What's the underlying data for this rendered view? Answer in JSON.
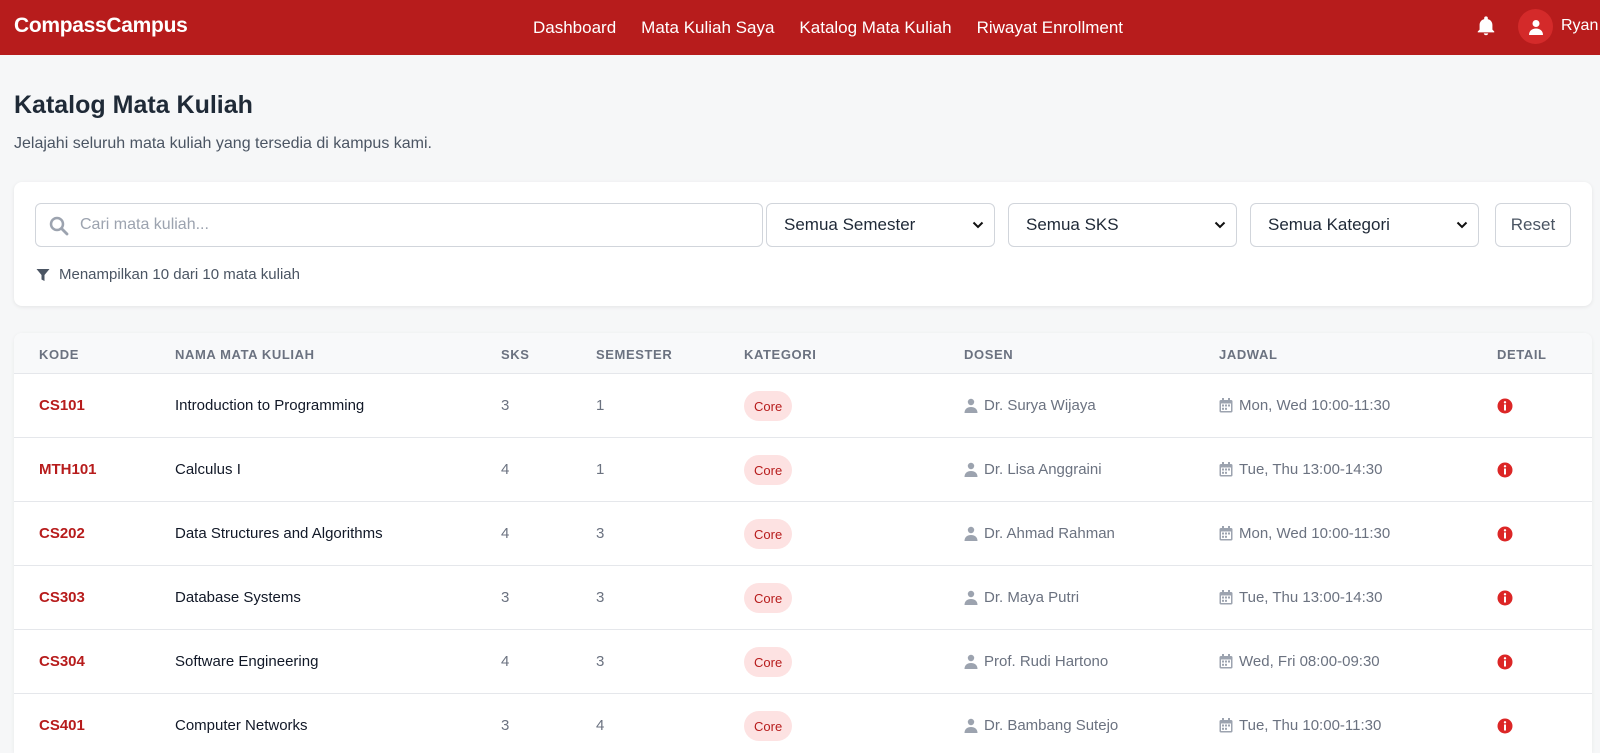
{
  "navbar": {
    "brand": "CompassCampus",
    "links": [
      "Dashboard",
      "Mata Kuliah Saya",
      "Katalog Mata Kuliah",
      "Riwayat Enrollment"
    ],
    "username": "Ryan"
  },
  "page": {
    "title": "Katalog Mata Kuliah",
    "subtitle": "Jelajahi seluruh mata kuliah yang tersedia di kampus kami."
  },
  "filters": {
    "search_placeholder": "Cari mata kuliah...",
    "semester": "Semua Semester",
    "sks": "Semua SKS",
    "kategori": "Semua Kategori",
    "reset_label": "Reset",
    "info": "Menampilkan 10 dari 10 mata kuliah"
  },
  "table": {
    "headers": [
      "KODE",
      "NAMA MATA KULIAH",
      "SKS",
      "SEMESTER",
      "KATEGORI",
      "DOSEN",
      "JADWAL",
      "DETAIL"
    ],
    "rows": [
      {
        "kode": "CS101",
        "nama": "Introduction to Programming",
        "sks": "3",
        "semester": "1",
        "kategori": "Core",
        "dosen": "Dr. Surya Wijaya",
        "jadwal": "Mon, Wed 10:00-11:30"
      },
      {
        "kode": "MTH101",
        "nama": "Calculus I",
        "sks": "4",
        "semester": "1",
        "kategori": "Core",
        "dosen": "Dr. Lisa Anggraini",
        "jadwal": "Tue, Thu 13:00-14:30"
      },
      {
        "kode": "CS202",
        "nama": "Data Structures and Algorithms",
        "sks": "4",
        "semester": "3",
        "kategori": "Core",
        "dosen": "Dr. Ahmad Rahman",
        "jadwal": "Mon, Wed 10:00-11:30"
      },
      {
        "kode": "CS303",
        "nama": "Database Systems",
        "sks": "3",
        "semester": "3",
        "kategori": "Core",
        "dosen": "Dr. Maya Putri",
        "jadwal": "Tue, Thu 13:00-14:30"
      },
      {
        "kode": "CS304",
        "nama": "Software Engineering",
        "sks": "4",
        "semester": "3",
        "kategori": "Core",
        "dosen": "Prof. Rudi Hartono",
        "jadwal": "Wed, Fri 08:00-09:30"
      },
      {
        "kode": "CS401",
        "nama": "Computer Networks",
        "sks": "3",
        "semester": "4",
        "kategori": "Core",
        "dosen": "Dr. Bambang Sutejo",
        "jadwal": "Tue, Thu 10:00-11:30"
      }
    ]
  },
  "colors": {
    "brand": "#b71c1c",
    "badge_bg": "#fde2e2"
  },
  "icons": [
    "bell-icon",
    "user-icon",
    "search-icon",
    "chevron-down-icon",
    "filter-icon",
    "person-icon",
    "calendar-icon",
    "info-icon"
  ]
}
